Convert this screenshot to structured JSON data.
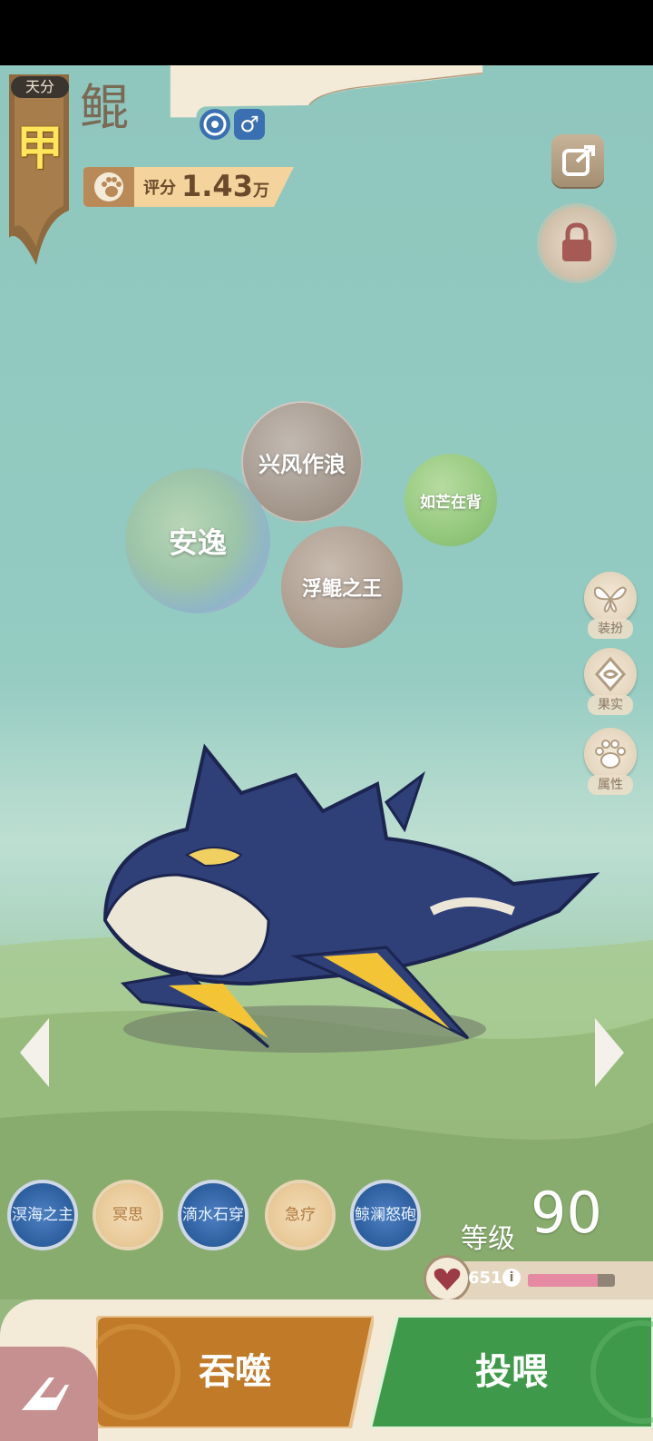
{
  "rank": {
    "tag": "天分",
    "grade": "甲"
  },
  "pet": {
    "name": "鲲",
    "element_icon": "water-swirl-icon",
    "gender_icon": "male-icon"
  },
  "score": {
    "label": "评分",
    "value": "1.43",
    "unit": "万"
  },
  "traits": [
    {
      "text": "兴风作浪"
    },
    {
      "text": "安逸"
    },
    {
      "text": "如芒在背"
    },
    {
      "text": "浮鲲之王"
    }
  ],
  "side_tools": [
    {
      "label": "装扮",
      "icon": "butterfly-icon"
    },
    {
      "label": "果实",
      "icon": "fruit-icon"
    },
    {
      "label": "属性",
      "icon": "paw-icon"
    }
  ],
  "skills": [
    {
      "text": "溟海之主",
      "style": "blue"
    },
    {
      "text": "冥思",
      "style": "gold"
    },
    {
      "text": "滴水石穿",
      "style": "blue"
    },
    {
      "text": "急疗",
      "style": "gold"
    },
    {
      "text": "鲸澜怒砲",
      "style": "blue"
    }
  ],
  "level": {
    "label": "等级",
    "value": "90"
  },
  "affection": {
    "value": "651",
    "bar_fill": 0.8
  },
  "actions": {
    "devour": "吞噬",
    "feed": "投喂"
  },
  "colors": {
    "grade_yellow": "#ffe65a",
    "devour_orange": "#c07a28",
    "feed_green": "#3e9a4a",
    "affection_pink": "#e58aa2"
  }
}
